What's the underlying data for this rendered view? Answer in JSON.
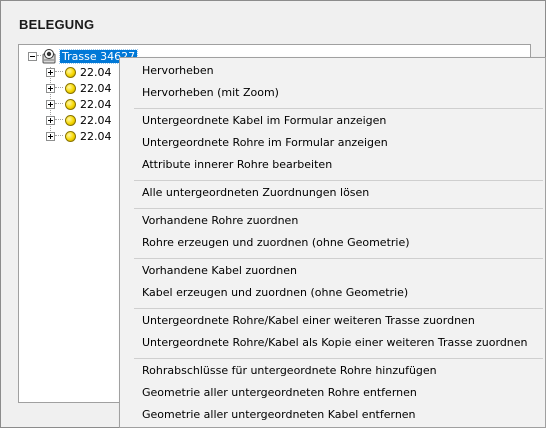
{
  "panel": {
    "title": "BELEGUNG"
  },
  "tree": {
    "root": {
      "label": "Trasse 34627",
      "icon": "network-node-icon",
      "expanded": true,
      "selected": true
    },
    "children": [
      {
        "label": "22.04",
        "icon": "yellow-bullet-icon"
      },
      {
        "label": "22.04",
        "icon": "yellow-bullet-icon"
      },
      {
        "label": "22.04",
        "icon": "yellow-bullet-icon"
      },
      {
        "label": "22.04",
        "icon": "yellow-bullet-icon"
      },
      {
        "label": "22.04",
        "icon": "yellow-bullet-icon"
      }
    ]
  },
  "context_menu": {
    "groups": [
      [
        "Hervorheben",
        "Hervorheben (mit Zoom)"
      ],
      [
        "Untergeordnete Kabel im Formular anzeigen",
        "Untergeordnete Rohre im Formular anzeigen",
        "Attribute innerer Rohre bearbeiten"
      ],
      [
        "Alle untergeordneten Zuordnungen lösen"
      ],
      [
        "Vorhandene Rohre zuordnen",
        "Rohre erzeugen und zuordnen (ohne Geometrie)"
      ],
      [
        "Vorhandene Kabel zuordnen",
        "Kabel erzeugen und zuordnen (ohne Geometrie)"
      ],
      [
        "Untergeordnete Rohre/Kabel einer weiteren Trasse zuordnen",
        "Untergeordnete Rohre/Kabel als Kopie einer weiteren Trasse zuordnen"
      ],
      [
        "Rohrabschlüsse für untergeordnete Rohre hinzufügen",
        "Geometrie aller untergeordneten Rohre entfernen",
        "Geometrie aller untergeordneten Kabel entfernen"
      ]
    ]
  },
  "colors": {
    "selection": "#0078d7",
    "menu_background": "#f2f2f2",
    "panel_background": "#f0f0f0"
  }
}
